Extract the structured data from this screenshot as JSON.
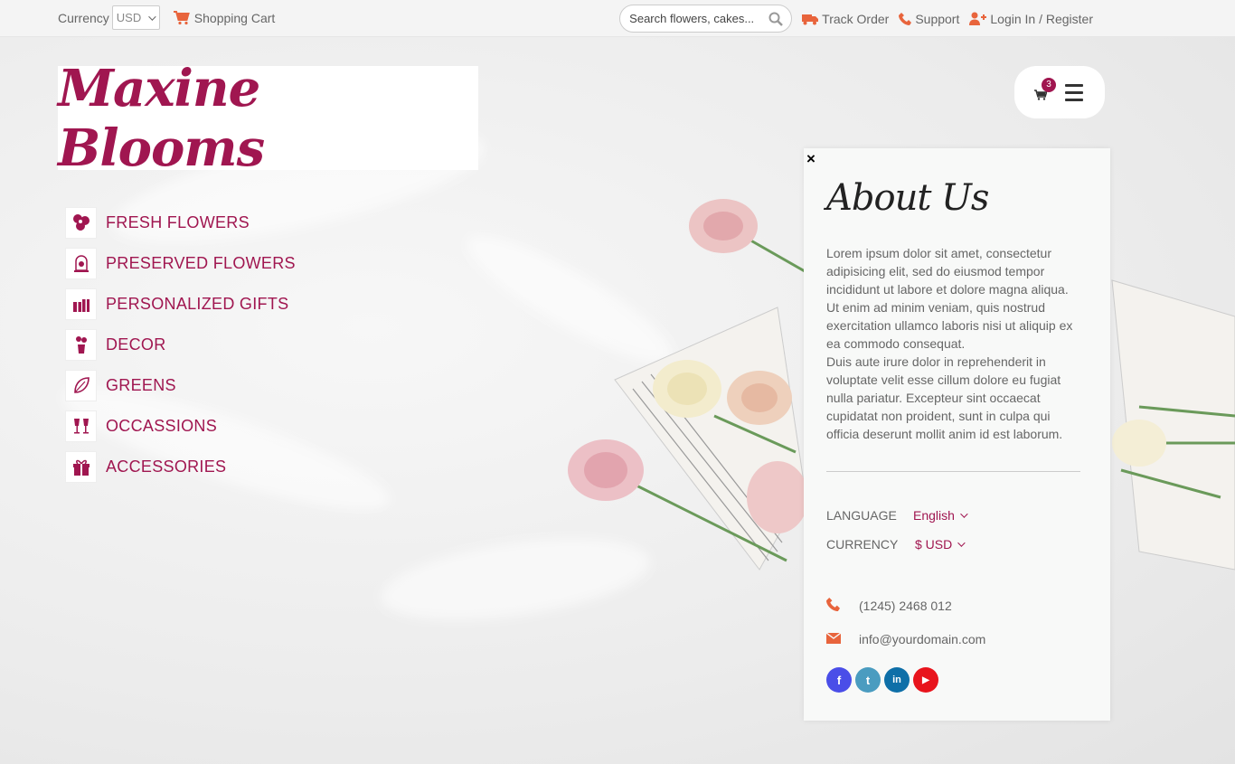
{
  "topbar": {
    "currency_label": "Currency",
    "currency_value": "USD",
    "cart_label": "Shopping Cart",
    "search_placeholder": "Search flowers, cakes...",
    "track_order": "Track Order",
    "support": "Support",
    "login": "Login In / Register"
  },
  "logo": {
    "text": "Maxine Blooms"
  },
  "cart": {
    "count": "3"
  },
  "categories": [
    {
      "label": "FRESH FLOWERS",
      "icon": "flower-icon"
    },
    {
      "label": "PRESERVED FLOWERS",
      "icon": "bell-jar-icon"
    },
    {
      "label": "PERSONALIZED GIFTS",
      "icon": "gift-icon"
    },
    {
      "label": "DECOR",
      "icon": "vase-icon"
    },
    {
      "label": "GREENS",
      "icon": "leaf-icon"
    },
    {
      "label": "OCCASSIONS",
      "icon": "cheers-icon"
    },
    {
      "label": "ACCESSORIES",
      "icon": "giftbox-icon"
    }
  ],
  "about": {
    "title": "About Us",
    "para1": "Lorem ipsum dolor sit amet, consectetur adipisicing elit, sed do eiusmod tempor incididunt ut labore et dolore magna aliqua. Ut enim ad minim veniam, quis nostrud exercitation ullamco laboris nisi ut aliquip ex ea commodo consequat.",
    "para2": "Duis aute irure dolor in reprehenderit in voluptate velit esse cillum dolore eu fugiat nulla pariatur. Excepteur sint occaecat cupidatat non proident, sunt in culpa qui officia deserunt mollit anim id est laborum.",
    "language_label": "LANGUAGE",
    "language_value": "English",
    "currency_label": "CURRENCY",
    "currency_value": "$ USD",
    "phone": "(1245) 2468 012",
    "email": "info@yourdomain.com",
    "close": "×"
  },
  "socials": [
    {
      "name": "facebook-icon",
      "glyph": "f",
      "color": "#4a4ee8"
    },
    {
      "name": "twitter-icon",
      "glyph": "t",
      "color": "#4a9cc0"
    },
    {
      "name": "linkedin-icon",
      "glyph": "in",
      "color": "#0e6fa8"
    },
    {
      "name": "youtube-icon",
      "glyph": "▶",
      "color": "#e8141c"
    }
  ],
  "colors": {
    "brand": "#a01650",
    "accent": "#e8643c"
  }
}
